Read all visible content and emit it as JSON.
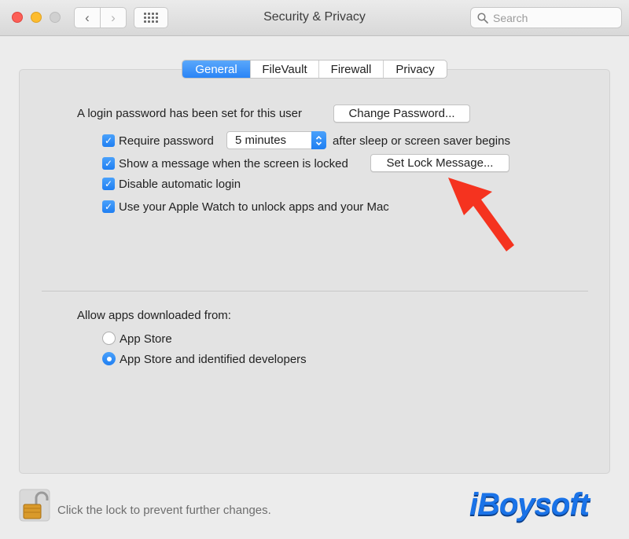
{
  "window": {
    "title": "Security & Privacy"
  },
  "toolbar": {
    "back": "‹",
    "forward": "›",
    "search_placeholder": "Search"
  },
  "tabs": [
    {
      "label": "General",
      "active": true
    },
    {
      "label": "FileVault",
      "active": false
    },
    {
      "label": "Firewall",
      "active": false
    },
    {
      "label": "Privacy",
      "active": false
    }
  ],
  "general": {
    "login_text": "A login password has been set for this user",
    "change_password_label": "Change Password...",
    "require_password_label": "Require password",
    "require_password_value": "5 minutes",
    "require_password_suffix": "after sleep or screen saver begins",
    "show_message_label": "Show a message when the screen is locked",
    "set_lock_message_label": "Set Lock Message...",
    "disable_login_label": "Disable automatic login",
    "apple_watch_label": "Use your Apple Watch to unlock apps and your Mac",
    "check_mark": "✓"
  },
  "downloads": {
    "heading": "Allow apps downloaded from:",
    "options": [
      {
        "label": "App Store",
        "selected": false
      },
      {
        "label": "App Store and identified developers",
        "selected": true
      }
    ]
  },
  "footer": {
    "lock_text": "Click the lock to prevent further changes."
  },
  "watermark": {
    "text": "iBoysoft"
  },
  "colors": {
    "accent": "#2a84f6",
    "arrow": "#f5331f",
    "brand": "#1a73e8"
  }
}
